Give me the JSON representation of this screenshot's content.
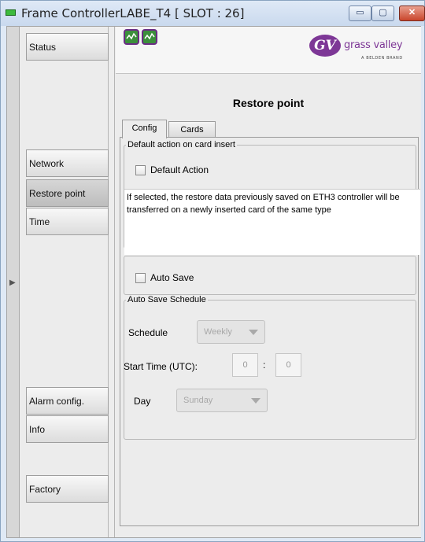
{
  "window": {
    "title": "Frame ControllerLABE_T4 [ SLOT : 26]",
    "buttons": {
      "minimize": "▭",
      "maximize": "▢",
      "close": "✕"
    }
  },
  "sidebar": {
    "items": [
      {
        "label": "Status",
        "active": false
      },
      {
        "label": "Network",
        "active": false
      },
      {
        "label": "Restore point",
        "active": true
      },
      {
        "label": "Time",
        "active": false
      },
      {
        "label": "Alarm config.",
        "active": false
      },
      {
        "label": "Info",
        "active": false
      },
      {
        "label": "Factory",
        "active": false
      }
    ]
  },
  "header": {
    "logo_text": "grass valley",
    "logo_mark": "GV",
    "logo_subtext": "A BELDEN BRAND",
    "status_icons": [
      "status-ok-icon",
      "status-ok-icon"
    ]
  },
  "page": {
    "title": "Restore point",
    "tabs": [
      {
        "label": "Config",
        "active": true
      },
      {
        "label": "Cards",
        "active": false
      }
    ]
  },
  "config": {
    "default_group": {
      "legend": "Default action on card insert",
      "checkbox_label": "Default Action",
      "checked": false,
      "description": "If selected, the restore data previously saved on ETH3 controller will be transferred on a newly inserted card of the same type"
    },
    "auto_save": {
      "checkbox_label": "Auto Save",
      "checked": false
    },
    "schedule_group": {
      "legend": "Auto Save Schedule",
      "schedule_label": "Schedule",
      "schedule_value": "Weekly",
      "start_time_label": "Start Time (UTC):",
      "hour": "0",
      "separator": ":",
      "minute": "0",
      "day_label": "Day",
      "day_value": "Sunday"
    }
  },
  "colors": {
    "brand": "#7d3796",
    "status_green": "#3c8f3c",
    "title_icon": "#3dbb3d",
    "close_button": "#c9462c"
  }
}
